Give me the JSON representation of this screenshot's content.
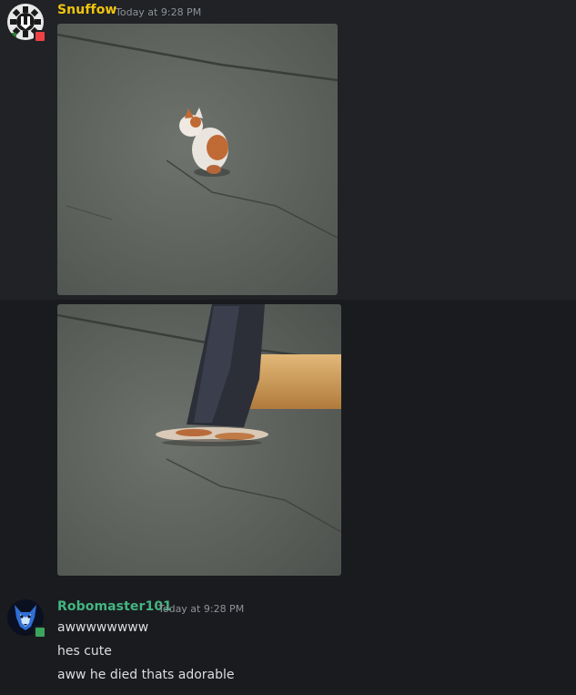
{
  "messages": [
    {
      "author": "Snuffow",
      "timestamp": "Today at 9:28 PM",
      "author_color": "#f1c40f",
      "status_color": "#ed4245",
      "attachments": [
        {
          "icon": "kitten-video-thumbnail"
        },
        {
          "icon": "mallet-video-thumbnail"
        }
      ]
    },
    {
      "author": "Robomaster101",
      "timestamp": "Today at 9:28 PM",
      "author_color": "#43b581",
      "status_color": "#3ba55d",
      "lines": [
        "awwwwwwww",
        "hes cute",
        "aww he died thats adorable"
      ]
    }
  ]
}
